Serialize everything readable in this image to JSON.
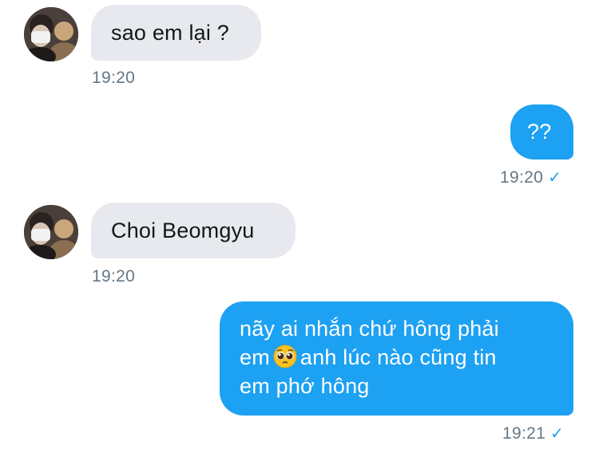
{
  "messages": [
    {
      "direction": "incoming",
      "text": "sao em lại ?",
      "time": "19:20"
    },
    {
      "direction": "outgoing",
      "text": "??",
      "time": "19:20",
      "status_icon": "check-icon"
    },
    {
      "direction": "incoming",
      "text": "Choi Beomgyu",
      "time": "19:20"
    },
    {
      "direction": "outgoing",
      "text_lines": [
        "nãy ai nhắn chứ hông phải",
        "em",
        "anh lúc nào cũng tin",
        "em phớ hông"
      ],
      "emoji": "pleading-face",
      "time": "19:21",
      "status_icon": "check-icon"
    }
  ],
  "colors": {
    "incoming_bubble": "#e7e9ee",
    "outgoing_bubble": "#1da1f2",
    "timestamp": "#657786",
    "check": "#1da1f2"
  }
}
